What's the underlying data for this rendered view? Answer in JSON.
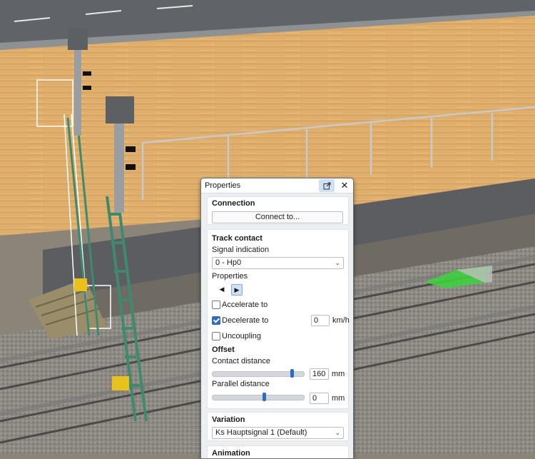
{
  "panel": {
    "title": "Properties",
    "connection": {
      "heading": "Connection",
      "connect_button": "Connect to..."
    },
    "track_contact": {
      "heading": "Track contact",
      "signal_indication_label": "Signal indication",
      "signal_indication_value": "0 - Hp0",
      "properties_label": "Properties",
      "accelerate_label": "Accelerate to",
      "accelerate_checked": false,
      "decelerate_label": "Decelerate to",
      "decelerate_checked": true,
      "decelerate_value": "0",
      "speed_unit": "km/h",
      "uncoupling_label": "Uncoupling",
      "uncoupling_checked": false
    },
    "offset": {
      "heading": "Offset",
      "contact_distance_label": "Contact distance",
      "contact_distance_value": "160",
      "parallel_distance_label": "Parallel distance",
      "parallel_distance_value": "0",
      "unit": "mm"
    },
    "variation": {
      "heading": "Variation",
      "value": "Ks Hauptsignal 1 (Default)"
    },
    "next_heading": "Animation"
  },
  "colors": {
    "accent": "#2b6cc4",
    "contact_marker": "#3fcf3f",
    "signal_mast": "#3f8a6e",
    "yellow_box": "#e8c21a"
  },
  "icons": {
    "popout": "external-window-icon",
    "close": "close-icon",
    "dropdown": "chevron-down-icon",
    "left": "triangle-left-icon",
    "right": "triangle-right-icon"
  }
}
